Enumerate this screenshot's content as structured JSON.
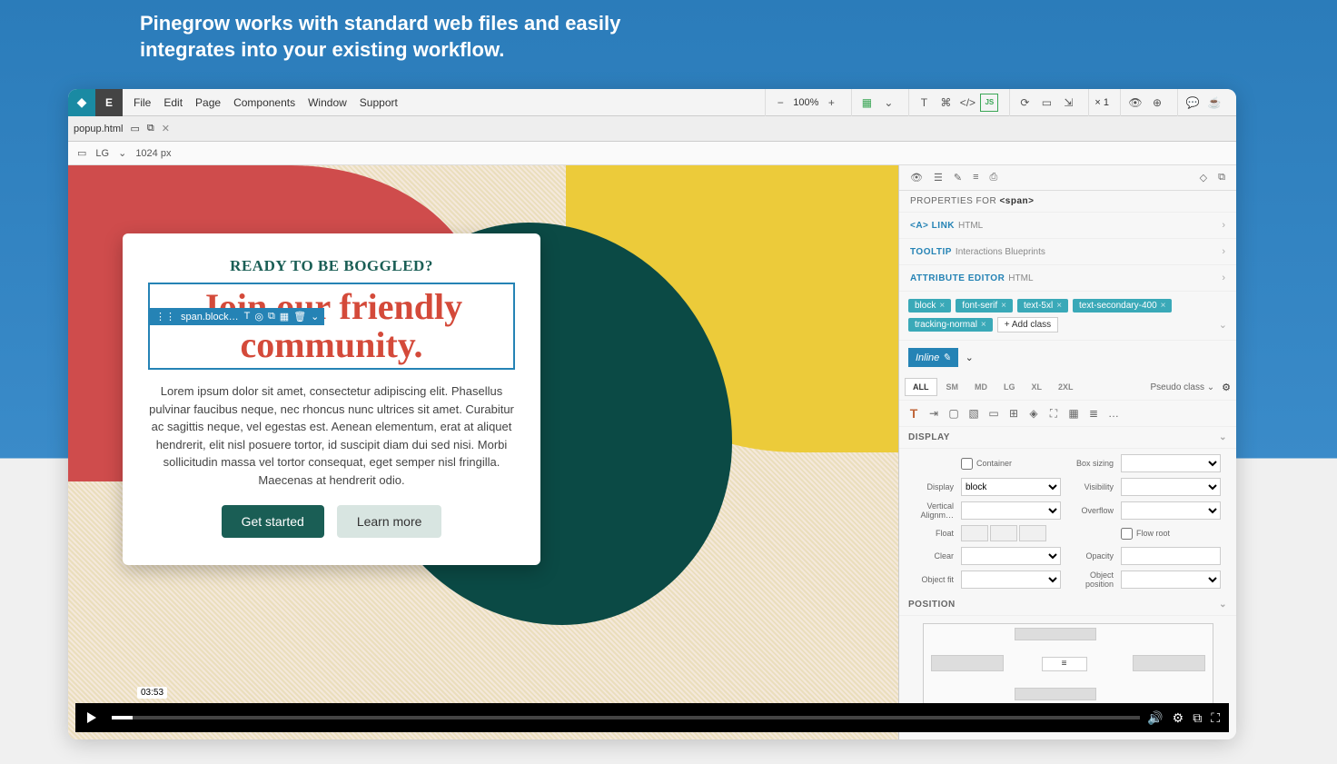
{
  "headline": "Pinegrow works with standard web files and easily integrates into your existing workflow.",
  "menubar": {
    "items": [
      "File",
      "Edit",
      "Page",
      "Components",
      "Window",
      "Support"
    ]
  },
  "zoom": {
    "pct": "100%",
    "multiplier": "× 1"
  },
  "tab": {
    "name": "popup.html"
  },
  "viewport": {
    "bp": "LG",
    "px": "1024 px"
  },
  "selection_chip": "span.block…",
  "popup": {
    "eyebrow": "READY TO BE BOGGLED?",
    "headline": "Join our friendly community.",
    "body": "Lorem ipsum dolor sit amet, consectetur adipiscing elit. Phasellus pulvinar faucibus neque, nec rhoncus nunc ultrices sit amet. Curabitur ac sagittis neque, vel egestas est. Aenean elementum, erat at aliquet hendrerit, elit nisl posuere tortor, id suscipit diam dui sed nisi. Morbi sollicitudin massa vel tortor consequat, eget semper nisl fringilla. Maecenas at hendrerit odio.",
    "btn_primary": "Get started",
    "btn_secondary": "Learn more"
  },
  "props": {
    "header_prefix": "PROPERTIES FOR",
    "header_tag": "<span>",
    "sections": [
      {
        "label": "<A> LINK",
        "sub": "HTML"
      },
      {
        "label": "TOOLTIP",
        "sub": "Interactions Blueprints"
      },
      {
        "label": "ATTRIBUTE EDITOR",
        "sub": "HTML"
      }
    ],
    "classes": [
      "block",
      "font-serif",
      "text-5xl",
      "text-secondary-400",
      "tracking-normal"
    ],
    "add_class": "+ Add class",
    "inline": "Inline",
    "breakpoints": [
      "ALL",
      "SM",
      "MD",
      "LG",
      "XL",
      "2XL"
    ],
    "pseudo": "Pseudo class",
    "display": {
      "title": "DISPLAY",
      "container": "Container",
      "box_sizing": "Box sizing",
      "display": "Display",
      "display_val": "block",
      "visibility": "Visibility",
      "valign": "Vertical Alignm…",
      "overflow": "Overflow",
      "float": "Float",
      "flow_root": "Flow root",
      "clear": "Clear",
      "opacity": "Opacity",
      "object_fit": "Object fit",
      "object_pos": "Object position"
    },
    "position": {
      "title": "POSITION"
    }
  },
  "video": {
    "time": "03:53"
  }
}
